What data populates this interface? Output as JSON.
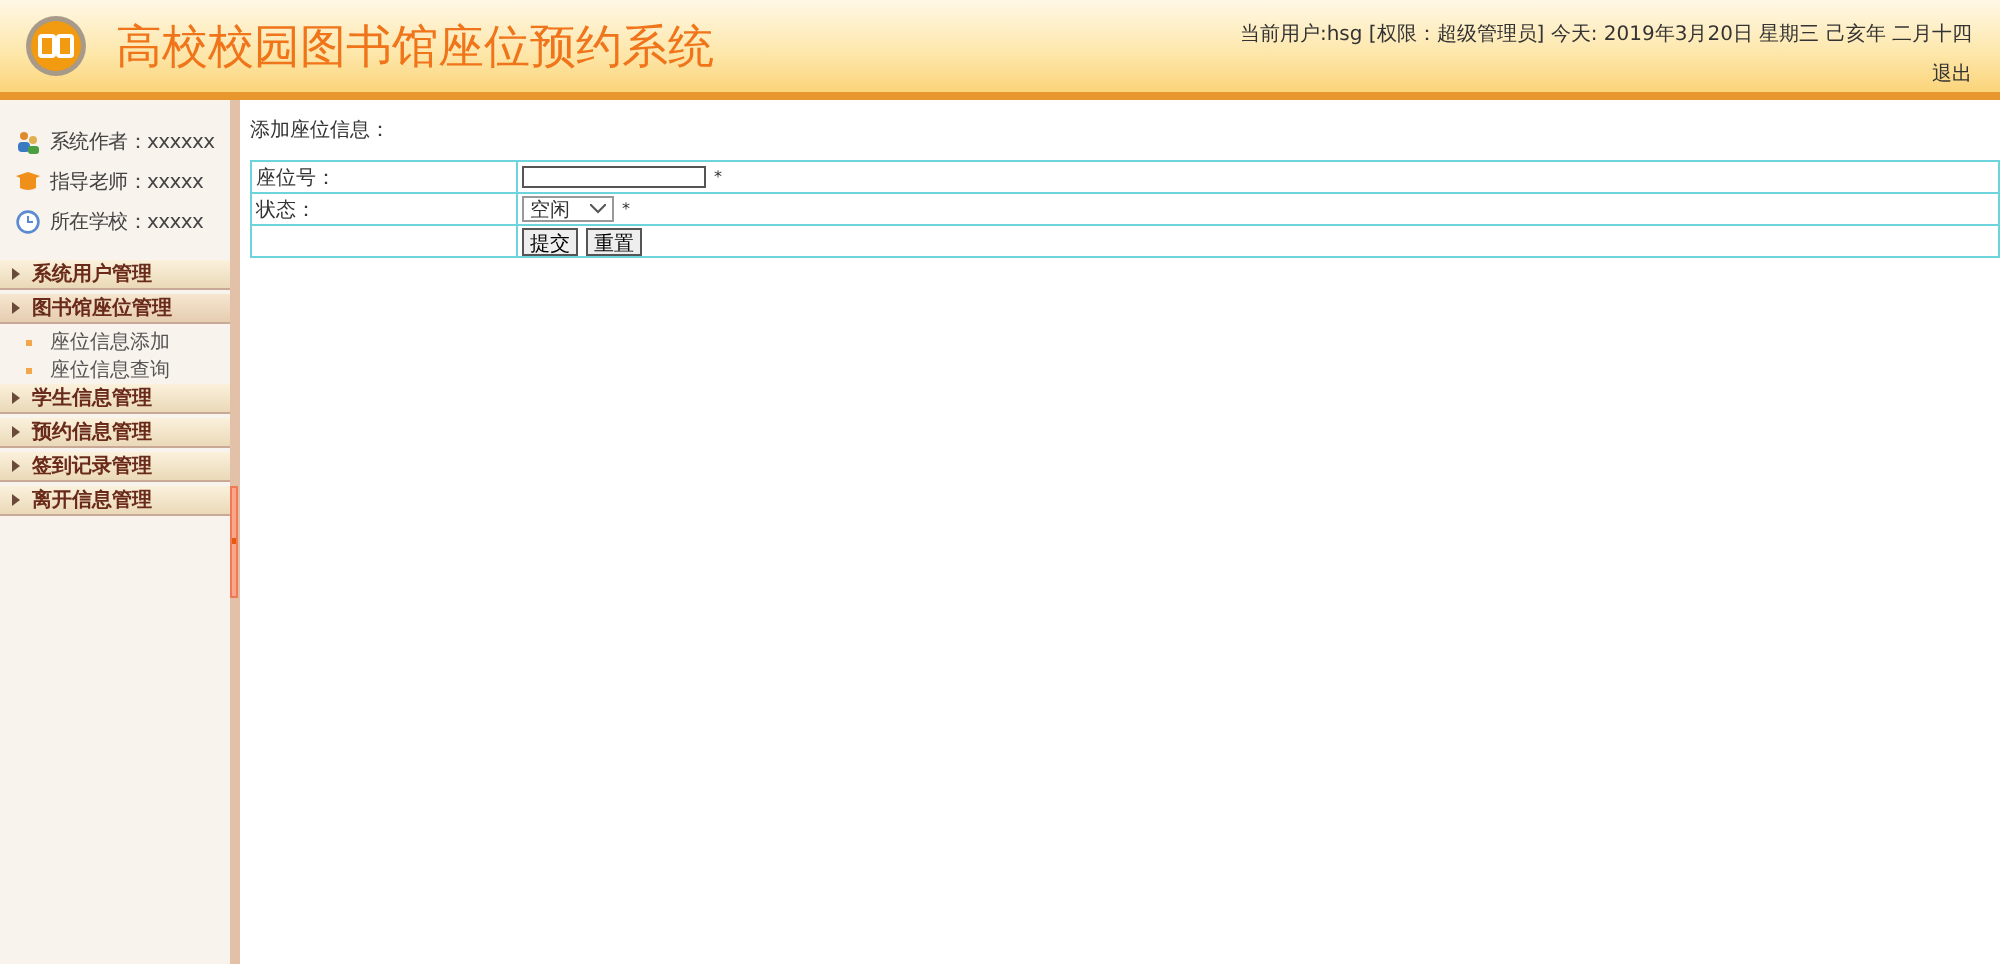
{
  "header": {
    "title": "高校校园图书馆座位预约系统",
    "user_info": "当前用户:hsg [权限：超级管理员] 今天:  2019年3月20日 星期三 己亥年 二月十四",
    "logout": "退出"
  },
  "sidebar": {
    "info": [
      {
        "kind": "author",
        "text": "系统作者：xxxxxx"
      },
      {
        "kind": "teacher",
        "text": "指导老师：xxxxx"
      },
      {
        "kind": "school",
        "text": "所在学校：xxxxx"
      }
    ],
    "menu": [
      {
        "label": "系统用户管理",
        "expanded": false
      },
      {
        "label": "图书馆座位管理",
        "expanded": true,
        "children": [
          {
            "label": "座位信息添加"
          },
          {
            "label": "座位信息查询"
          }
        ]
      },
      {
        "label": "学生信息管理",
        "expanded": false
      },
      {
        "label": "预约信息管理",
        "expanded": false
      },
      {
        "label": "签到记录管理",
        "expanded": false
      },
      {
        "label": "离开信息管理",
        "expanded": false
      }
    ]
  },
  "form": {
    "title": "添加座位信息：",
    "fields": [
      {
        "kind": "text",
        "label": "座位号：",
        "required_mark": "*"
      },
      {
        "kind": "select",
        "label": "状态：",
        "value": "空闲",
        "required_mark": "*"
      }
    ],
    "buttons": [
      "提交",
      "重置"
    ]
  }
}
